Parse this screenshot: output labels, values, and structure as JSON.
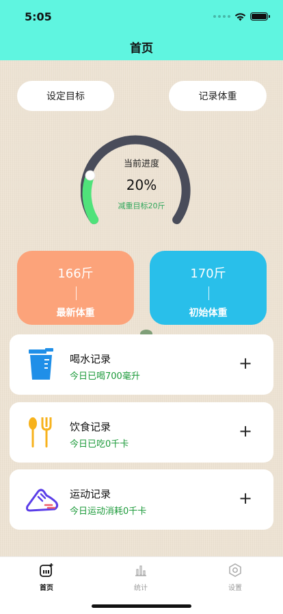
{
  "status_bar": {
    "time": "5:05"
  },
  "header": {
    "title": "首页"
  },
  "actions": {
    "set_goal": "设定目标",
    "record_weight": "记录体重"
  },
  "progress": {
    "label": "当前进度",
    "percent_text": "20%",
    "value": 0.2,
    "target": "减重目标20斤",
    "track_color": "#494c5a",
    "fill_color": "#4fe27a"
  },
  "weights": {
    "latest": {
      "value": "166斤",
      "label": "最新体重",
      "color": "#fca37a"
    },
    "initial": {
      "value": "170斤",
      "label": "初始体重",
      "color": "#29bfea"
    }
  },
  "records": [
    {
      "title": "喝水记录",
      "subtitle": "今日已喝700毫升",
      "icon": "water-cup-icon",
      "action": "+"
    },
    {
      "title": "饮食记录",
      "subtitle": "今日已吃0千卡",
      "icon": "spoon-fork-icon",
      "action": "+"
    },
    {
      "title": "运动记录",
      "subtitle": "今日运动消耗0千卡",
      "icon": "sneaker-icon",
      "action": "+"
    }
  ],
  "tabs": [
    {
      "label": "首页",
      "icon": "scale-icon",
      "active": true
    },
    {
      "label": "统计",
      "icon": "bar-chart-icon",
      "active": false
    },
    {
      "label": "设置",
      "icon": "hexagon-settings-icon",
      "active": false
    }
  ]
}
